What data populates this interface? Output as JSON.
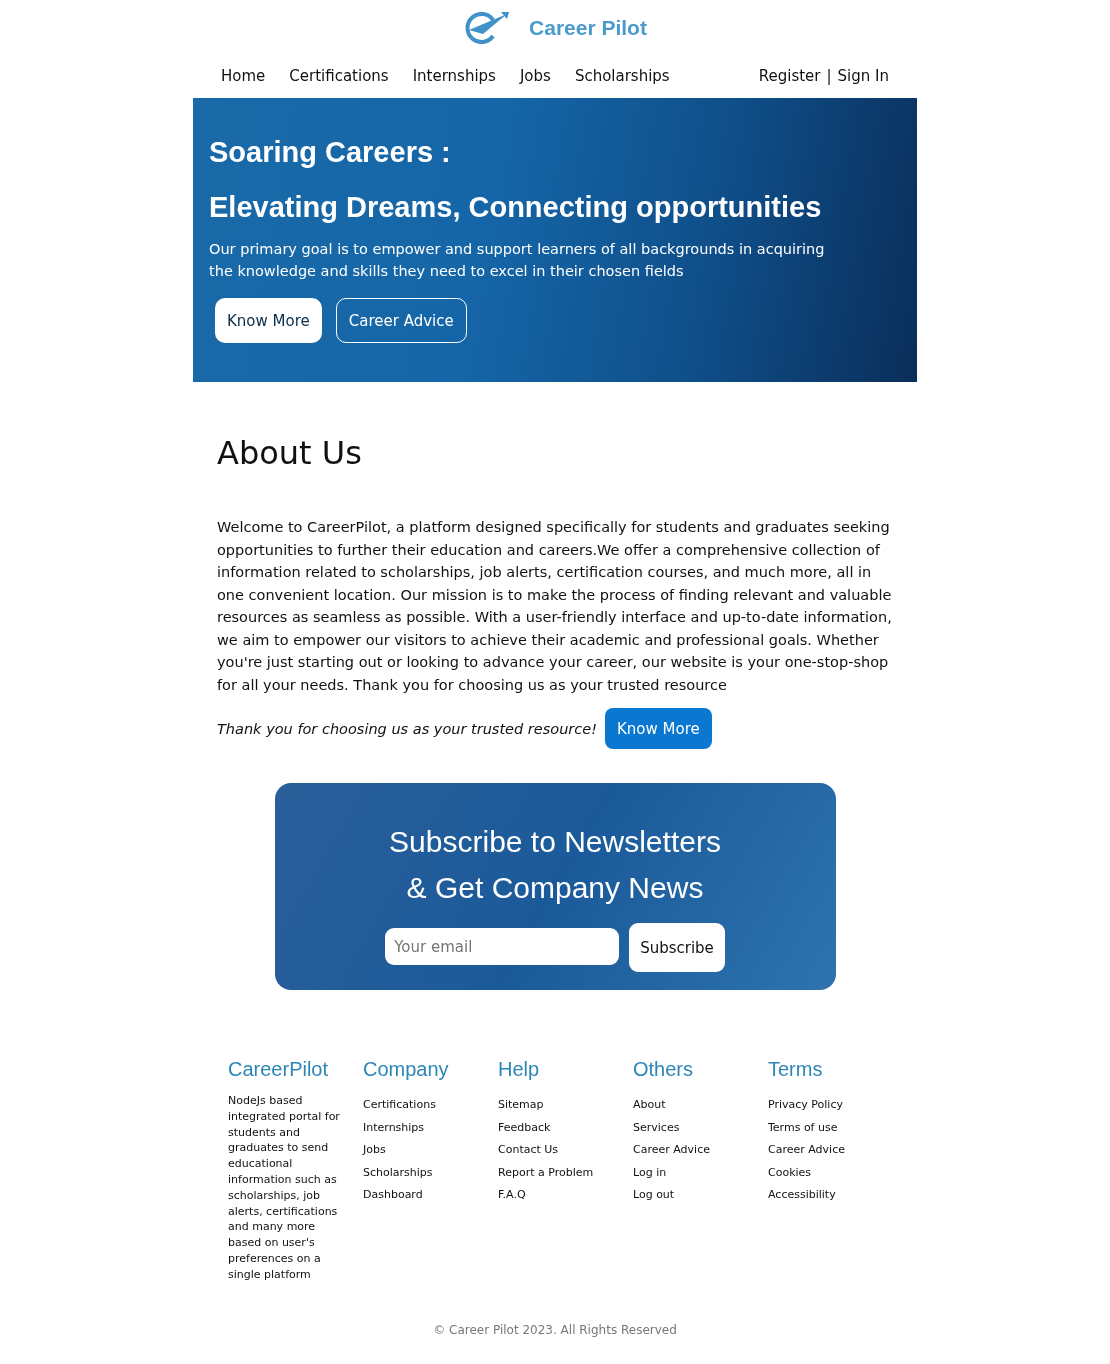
{
  "header": {
    "brand": "Career Pilot"
  },
  "nav": {
    "links": [
      "Home",
      "Certifications",
      "Internships",
      "Jobs",
      "Scholarships"
    ],
    "account": [
      "Register",
      "|",
      "Sign In"
    ]
  },
  "hero": {
    "title": "Soaring Careers :",
    "subtitle": "Elevating Dreams, Connecting opportunities",
    "text": "Our primary goal is to empower and support learners of all backgrounds in acquiring the knowledge and skills they need to excel in their chosen fields",
    "buttons": [
      {
        "label": "Know More",
        "kind": "solid"
      },
      {
        "label": "Career Advice",
        "kind": "outline"
      }
    ]
  },
  "about": {
    "title": "About Us",
    "text": "Welcome to CareerPilot, a platform designed specifically for students and graduates seeking opportunities to further their education and careers.We offer a comprehensive collection of information related to scholarships, job alerts, certification courses, and much more, all in one convenient location. Our mission is to make the process of finding relevant and valuable resources as seamless as possible. With a user-friendly interface and up-to-date information, we aim to empower our visitors to achieve their academic and professional goals. Whether you're just starting out or looking to advance your career, our website is your one-stop-shop for all your needs. Thank you for choosing us as your trusted resource",
    "tagline": "Thank you for choosing us as your trusted resource!",
    "button": "Know More"
  },
  "newsletter": {
    "title_lines": [
      "Subscribe to Newsletters",
      "& Get Company News"
    ],
    "placeholder": "Your email",
    "button": "Subscribe"
  },
  "footer": {
    "columns": [
      {
        "title": "CareerPilot",
        "kind": "text",
        "text": "NodeJs based integrated portal for students and graduates to send educational information such as scholarships, job alerts, certifications and many more based on user's preferences on a single platform"
      },
      {
        "title": "Company",
        "kind": "links",
        "links": [
          "Certifications",
          "Internships",
          "Jobs",
          "Scholarships",
          "Dashboard"
        ]
      },
      {
        "title": "Help",
        "kind": "links",
        "links": [
          "Sitemap",
          "Feedback",
          "Contact Us",
          "Report a Problem",
          "F.A.Q"
        ]
      },
      {
        "title": "Others",
        "kind": "links",
        "links": [
          "About",
          "Services",
          "Career Advice",
          "Log in",
          "Log out"
        ]
      },
      {
        "title": "Terms",
        "kind": "links",
        "links": [
          "Privacy Policy",
          "Terms of use",
          "Career Advice",
          "Cookies",
          "Accessibility"
        ]
      }
    ],
    "copyright": "© Career Pilot 2023. All Rights Reserved"
  }
}
